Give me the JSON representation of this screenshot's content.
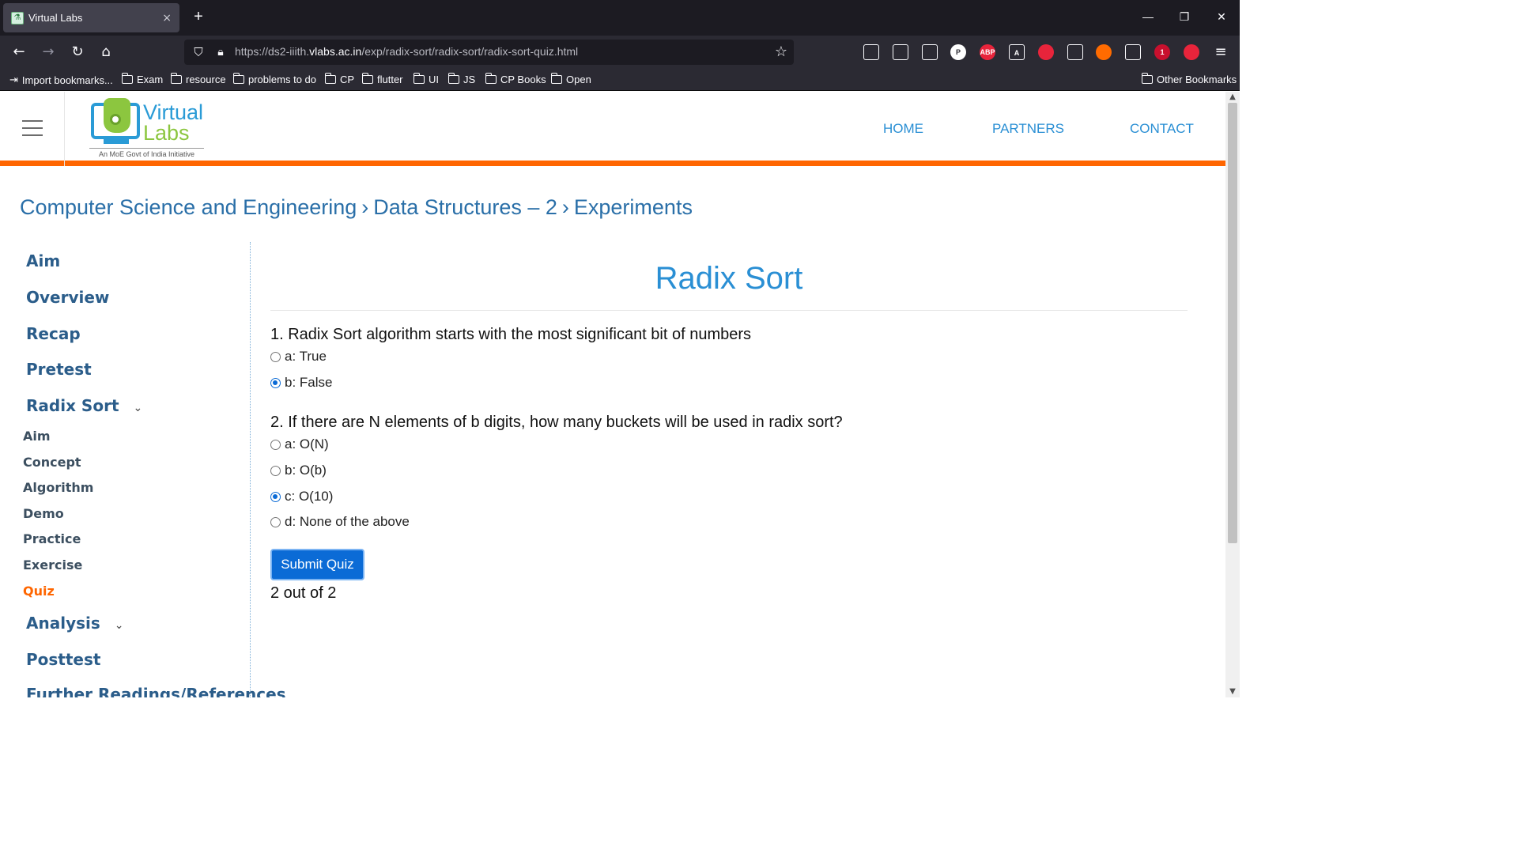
{
  "browser": {
    "tab_title": "Virtual Labs",
    "tab_close": "×",
    "new_tab": "+",
    "url_prefix": "https://ds2-iiith.",
    "url_domain": "vlabs.ac.in",
    "url_path": "/exp/radix-sort/radix-sort/radix-sort-quiz.html",
    "bookmarks": [
      {
        "label": "Import bookmarks...",
        "icon": "import-icon"
      },
      {
        "label": "Exam",
        "icon": "folder-icon"
      },
      {
        "label": "resource",
        "icon": "folder-icon"
      },
      {
        "label": "problems to do",
        "icon": "folder-icon"
      },
      {
        "label": "CP",
        "icon": "folder-icon"
      },
      {
        "label": "flutter",
        "icon": "folder-icon"
      },
      {
        "label": "UI",
        "icon": "folder-icon"
      },
      {
        "label": "JS",
        "icon": "folder-icon"
      },
      {
        "label": "CP Books",
        "icon": "folder-icon"
      },
      {
        "label": "Open",
        "icon": "folder-icon"
      }
    ],
    "other_bookmarks": "Other Bookmarks",
    "extensions": [
      {
        "name": "pocket-icon",
        "label": "",
        "color": "#2b2a33"
      },
      {
        "name": "library-icon",
        "label": "",
        "color": "#2b2a33"
      },
      {
        "name": "sidebar-icon",
        "label": "",
        "color": "#2b2a33"
      },
      {
        "name": "p-extension-icon",
        "label": "P",
        "color": "#ffffff"
      },
      {
        "name": "adblock-plus-icon",
        "label": "ABP",
        "color": "#e8243b"
      },
      {
        "name": "font-extension-icon",
        "label": "A",
        "color": "#2b2a33"
      },
      {
        "name": "pdf-extension-icon",
        "label": "",
        "color": "#e8243b"
      },
      {
        "name": "color-picker-icon",
        "label": "",
        "color": "#2b2a33"
      },
      {
        "name": "ublock-icon",
        "label": "",
        "color": "#ff6b00"
      },
      {
        "name": "mask-extension-icon",
        "label": "",
        "color": "#2b2a33"
      },
      {
        "name": "tampermonkey-icon",
        "label": "1",
        "color": "#c8102e"
      },
      {
        "name": "edit-extension-icon",
        "label": "",
        "color": "#e8243b"
      }
    ]
  },
  "site": {
    "logo_line1": "Virtual",
    "logo_line2": "Labs",
    "logo_tagline": "An MoE Govt of India Initiative",
    "nav": [
      "HOME",
      "PARTNERS",
      "CONTACT"
    ],
    "breadcrumb": [
      "Computer Science and Engineering",
      "Data Structures – 2",
      "Experiments"
    ],
    "breadcrumb_separator": "›"
  },
  "sidebar": {
    "main_items": [
      "Aim",
      "Overview",
      "Recap",
      "Pretest",
      "Radix Sort"
    ],
    "sub_items": [
      "Aim",
      "Concept",
      "Algorithm",
      "Demo",
      "Practice",
      "Exercise",
      "Quiz"
    ],
    "active_sub_item": "Quiz",
    "after_items": [
      "Analysis",
      "Posttest",
      "Further Readings/References"
    ]
  },
  "quiz": {
    "title": "Radix Sort",
    "questions": [
      {
        "text": "1. Radix Sort algorithm starts with the most significant bit of numbers",
        "options": [
          "a: True",
          "b: False"
        ],
        "selected": 1
      },
      {
        "text": "2. If there are N elements of b digits, how many buckets will be used in radix sort?",
        "options": [
          "a: O(N)",
          "b: O(b)",
          "c: O(10)",
          "d: None of the above"
        ],
        "selected": 2
      }
    ],
    "submit_label": "Submit Quiz",
    "score_text": "2 out of 2"
  },
  "colors": {
    "accent_orange": "#ff6600",
    "link_blue": "#2a8fd4",
    "button_blue": "#0b6bd6"
  }
}
